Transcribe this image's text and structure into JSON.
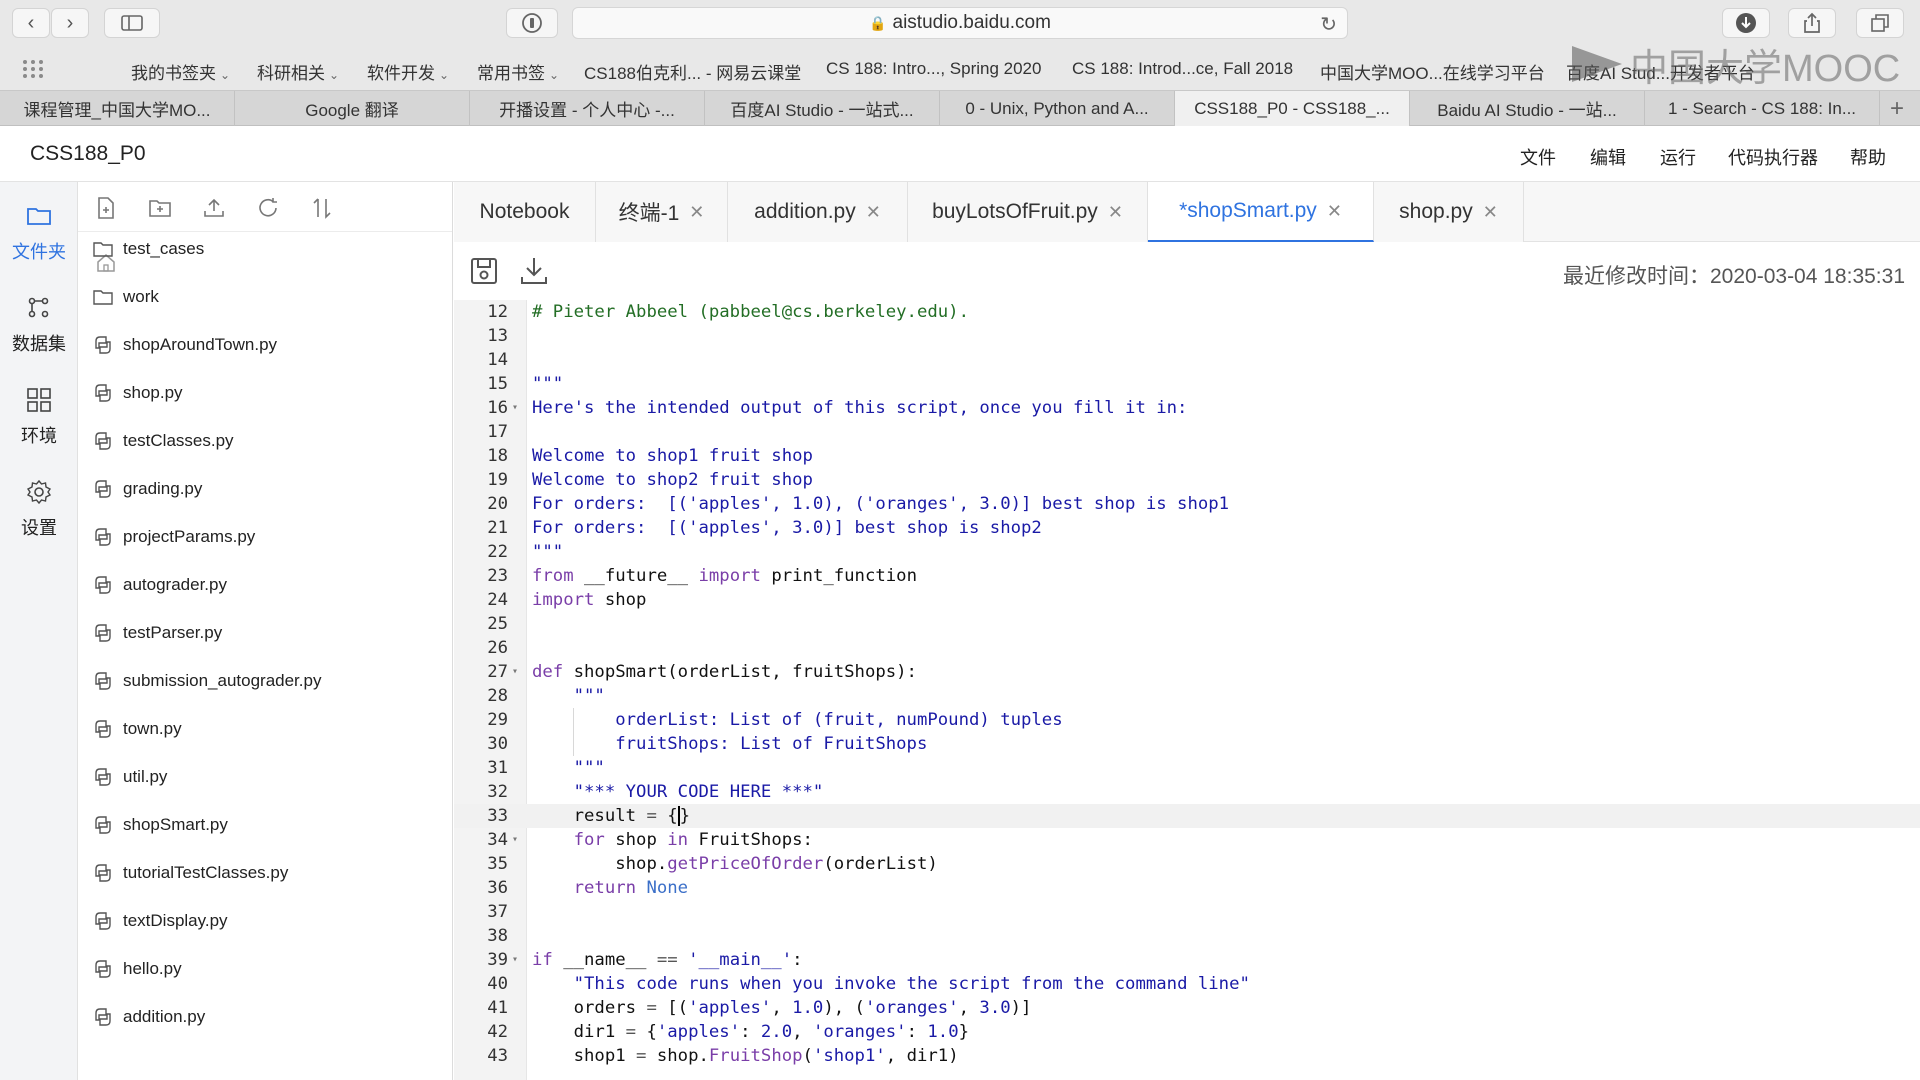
{
  "browser": {
    "url": "aistudio.baidu.com",
    "bookmarks": [
      {
        "label": "我的书签夹",
        "folder": true
      },
      {
        "label": "科研相关",
        "folder": true
      },
      {
        "label": "软件开发",
        "folder": true
      },
      {
        "label": "常用书签",
        "folder": true
      },
      {
        "label": "CS188伯克利... - 网易云课堂",
        "folder": false
      },
      {
        "label": "CS 188: Intro..., Spring 2020",
        "folder": false
      },
      {
        "label": "CS 188: Introd...ce, Fall 2018",
        "folder": false
      },
      {
        "label": "中国大学MOO...在线学习平台",
        "folder": false
      },
      {
        "label": "百度AI Stud...开发者平台",
        "folder": false
      }
    ],
    "tabs": [
      {
        "label": "课程管理_中国大学MO...",
        "active": false
      },
      {
        "label": "Google 翻译",
        "active": false
      },
      {
        "label": "开播设置 - 个人中心 -...",
        "active": false
      },
      {
        "label": "百度AI Studio - 一站式...",
        "active": false
      },
      {
        "label": "0 - Unix, Python and A...",
        "active": false
      },
      {
        "label": "CSS188_P0 - CSS188_...",
        "active": true
      },
      {
        "label": "Baidu AI Studio - 一站...",
        "active": false
      },
      {
        "label": "1 - Search - CS 188: In...",
        "active": false
      }
    ]
  },
  "watermark": "中国大学MOOC",
  "app": {
    "title": "CSS188_P0",
    "menu": [
      "文件",
      "编辑",
      "运行",
      "代码执行器",
      "帮助"
    ]
  },
  "rail": [
    {
      "label": "文件夹",
      "icon": "folder-icon",
      "active": true
    },
    {
      "label": "数据集",
      "icon": "dataset-icon",
      "active": false
    },
    {
      "label": "环境",
      "icon": "grid-icon",
      "active": false
    },
    {
      "label": "设置",
      "icon": "gear-icon",
      "active": false
    }
  ],
  "files": [
    {
      "name": "test_cases",
      "type": "folder"
    },
    {
      "name": "work",
      "type": "folder"
    },
    {
      "name": "shopAroundTown.py",
      "type": "python"
    },
    {
      "name": "shop.py",
      "type": "python"
    },
    {
      "name": "testClasses.py",
      "type": "python"
    },
    {
      "name": "grading.py",
      "type": "python"
    },
    {
      "name": "projectParams.py",
      "type": "python"
    },
    {
      "name": "autograder.py",
      "type": "python"
    },
    {
      "name": "testParser.py",
      "type": "python"
    },
    {
      "name": "submission_autograder.py",
      "type": "python"
    },
    {
      "name": "town.py",
      "type": "python"
    },
    {
      "name": "util.py",
      "type": "python"
    },
    {
      "name": "shopSmart.py",
      "type": "python"
    },
    {
      "name": "tutorialTestClasses.py",
      "type": "python"
    },
    {
      "name": "textDisplay.py",
      "type": "python"
    },
    {
      "name": "hello.py",
      "type": "python"
    },
    {
      "name": "addition.py",
      "type": "python"
    }
  ],
  "editor": {
    "tabs": [
      {
        "label": "Notebook",
        "closable": false,
        "active": false
      },
      {
        "label": "终端-1",
        "closable": true,
        "active": false
      },
      {
        "label": "addition.py",
        "closable": true,
        "active": false
      },
      {
        "label": "buyLotsOfFruit.py",
        "closable": true,
        "active": false
      },
      {
        "label": "*shopSmart.py",
        "closable": true,
        "active": true
      },
      {
        "label": "shop.py",
        "closable": true,
        "active": false
      }
    ],
    "modified_label": "最近修改时间：",
    "modified_time": "2020-03-04 18:35:31",
    "current_line": 33,
    "lines": [
      {
        "n": 12,
        "fold": false,
        "segs": [
          [
            "c-cm",
            "# Pieter Abbeel (pabbeel@cs.berkeley.edu)."
          ]
        ]
      },
      {
        "n": 13,
        "fold": false,
        "segs": []
      },
      {
        "n": 14,
        "fold": false,
        "segs": []
      },
      {
        "n": 15,
        "fold": false,
        "segs": [
          [
            "c-str",
            "\"\"\""
          ]
        ]
      },
      {
        "n": 16,
        "fold": true,
        "segs": [
          [
            "c-str",
            "Here's the intended output of this script, once you fill it in:"
          ]
        ]
      },
      {
        "n": 17,
        "fold": false,
        "segs": []
      },
      {
        "n": 18,
        "fold": false,
        "segs": [
          [
            "c-str",
            "Welcome to shop1 fruit shop"
          ]
        ]
      },
      {
        "n": 19,
        "fold": false,
        "segs": [
          [
            "c-str",
            "Welcome to shop2 fruit shop"
          ]
        ]
      },
      {
        "n": 20,
        "fold": false,
        "segs": [
          [
            "c-str",
            "For orders:  [('apples', 1.0), ('oranges', 3.0)] best shop is shop1"
          ]
        ]
      },
      {
        "n": 21,
        "fold": false,
        "segs": [
          [
            "c-str",
            "For orders:  [('apples', 3.0)] best shop is shop2"
          ]
        ]
      },
      {
        "n": 22,
        "fold": false,
        "segs": [
          [
            "c-str",
            "\"\"\""
          ]
        ]
      },
      {
        "n": 23,
        "fold": false,
        "segs": [
          [
            "c-kw",
            "from"
          ],
          [
            "",
            " __future__ "
          ],
          [
            "c-kw",
            "import"
          ],
          [
            "",
            " print_function"
          ]
        ]
      },
      {
        "n": 24,
        "fold": false,
        "segs": [
          [
            "c-kw",
            "import"
          ],
          [
            "",
            " shop"
          ]
        ]
      },
      {
        "n": 25,
        "fold": false,
        "segs": []
      },
      {
        "n": 26,
        "fold": false,
        "segs": []
      },
      {
        "n": 27,
        "fold": true,
        "segs": [
          [
            "c-kw",
            "def"
          ],
          [
            "",
            " shopSmart(orderList, fruitShops):"
          ]
        ]
      },
      {
        "n": 28,
        "fold": false,
        "segs": [
          [
            "",
            "    "
          ],
          [
            "c-str",
            "\"\"\""
          ]
        ]
      },
      {
        "n": 29,
        "fold": false,
        "segs": [
          [
            "",
            "        "
          ],
          [
            "c-str",
            "orderList: List of (fruit, numPound) tuples"
          ]
        ]
      },
      {
        "n": 30,
        "fold": false,
        "segs": [
          [
            "",
            "        "
          ],
          [
            "c-str",
            "fruitShops: List of FruitShops"
          ]
        ]
      },
      {
        "n": 31,
        "fold": false,
        "segs": [
          [
            "",
            "    "
          ],
          [
            "c-str",
            "\"\"\""
          ]
        ]
      },
      {
        "n": 32,
        "fold": false,
        "segs": [
          [
            "",
            "    "
          ],
          [
            "c-str",
            "\"*** YOUR CODE HERE ***\""
          ]
        ]
      },
      {
        "n": 33,
        "fold": false,
        "segs": [
          [
            "",
            "    result "
          ],
          [
            "c-fn",
            "="
          ],
          [
            "",
            " {"
          ],
          [
            "cursor",
            ""
          ],
          [
            "",
            "}"
          ]
        ]
      },
      {
        "n": 34,
        "fold": true,
        "segs": [
          [
            "",
            "    "
          ],
          [
            "c-kw",
            "for"
          ],
          [
            "",
            " shop "
          ],
          [
            "c-kw",
            "in"
          ],
          [
            "",
            " FruitShops:"
          ]
        ]
      },
      {
        "n": 35,
        "fold": false,
        "segs": [
          [
            "",
            "        shop."
          ],
          [
            "c-kw",
            "getPriceOfOrder"
          ],
          [
            "",
            "(orderList)"
          ]
        ]
      },
      {
        "n": 36,
        "fold": false,
        "segs": [
          [
            "",
            "    "
          ],
          [
            "c-kw",
            "return"
          ],
          [
            "",
            " "
          ],
          [
            "c-none",
            "None"
          ]
        ]
      },
      {
        "n": 37,
        "fold": false,
        "segs": []
      },
      {
        "n": 38,
        "fold": false,
        "segs": []
      },
      {
        "n": 39,
        "fold": true,
        "segs": [
          [
            "c-kw",
            "if"
          ],
          [
            "",
            " __name__ "
          ],
          [
            "c-fn",
            "=="
          ],
          [
            "",
            " "
          ],
          [
            "c-str",
            "'__main__'"
          ],
          [
            "",
            ":"
          ]
        ]
      },
      {
        "n": 40,
        "fold": false,
        "segs": [
          [
            "",
            "    "
          ],
          [
            "c-str",
            "\"This code runs when you invoke the script from the command line\""
          ]
        ]
      },
      {
        "n": 41,
        "fold": false,
        "segs": [
          [
            "",
            "    orders "
          ],
          [
            "c-fn",
            "="
          ],
          [
            "",
            " [("
          ],
          [
            "c-str",
            "'apples'"
          ],
          [
            "",
            ", "
          ],
          [
            "c-str",
            "1.0"
          ],
          [
            "",
            "), ("
          ],
          [
            "c-str",
            "'oranges'"
          ],
          [
            "",
            ", "
          ],
          [
            "c-str",
            "3.0"
          ],
          [
            "",
            ")]"
          ]
        ]
      },
      {
        "n": 42,
        "fold": false,
        "segs": [
          [
            "",
            "    dir1 "
          ],
          [
            "c-fn",
            "="
          ],
          [
            "",
            " {"
          ],
          [
            "c-str",
            "'apples'"
          ],
          [
            "",
            ": "
          ],
          [
            "c-str",
            "2.0"
          ],
          [
            "",
            ", "
          ],
          [
            "c-str",
            "'oranges'"
          ],
          [
            "",
            ": "
          ],
          [
            "c-str",
            "1.0"
          ],
          [
            "",
            "}"
          ]
        ]
      },
      {
        "n": 43,
        "fold": false,
        "segs": [
          [
            "",
            "    shop1 "
          ],
          [
            "c-fn",
            "="
          ],
          [
            "",
            " shop."
          ],
          [
            "c-kw",
            "FruitShop"
          ],
          [
            "",
            "("
          ],
          [
            "c-str",
            "'shop1'"
          ],
          [
            "",
            ", dir1)"
          ]
        ]
      }
    ]
  }
}
